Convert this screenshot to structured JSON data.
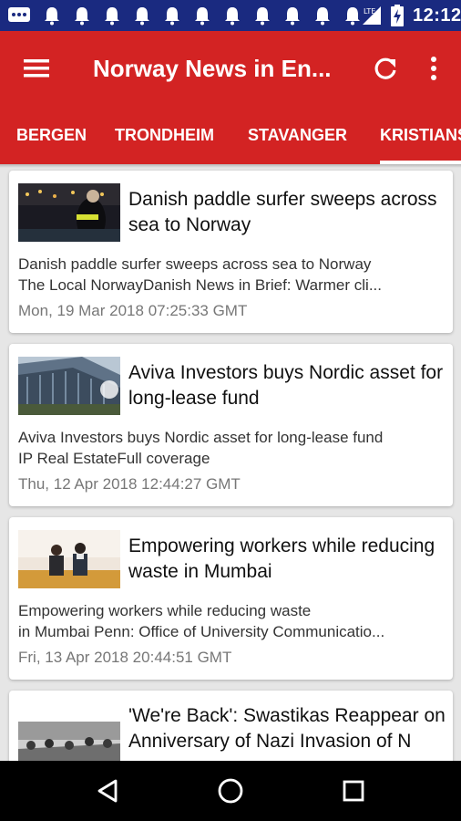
{
  "status_bar": {
    "time": "12:12",
    "network_label": "LTE",
    "notification_icons": [
      "message-icon",
      "bell-icon",
      "bell-icon",
      "bell-icon",
      "bell-icon",
      "bell-icon",
      "bell-icon",
      "bell-icon",
      "bell-icon",
      "bell-icon",
      "bell-icon",
      "bell-icon"
    ]
  },
  "app_bar": {
    "title": "Norway News in En...",
    "menu_icon": "hamburger-menu-icon",
    "refresh_icon": "refresh-icon",
    "more_icon": "more-vert-icon",
    "color": "#d32323"
  },
  "tabs": [
    {
      "label": "BERGEN"
    },
    {
      "label": "TRONDHEIM"
    },
    {
      "label": "STAVANGER"
    },
    {
      "label": "KRISTIANS"
    }
  ],
  "active_tab_index": 3,
  "articles": [
    {
      "title": "Danish paddle surfer sweeps across sea to Norway",
      "desc_line1": "Danish paddle surfer sweeps across sea to Norway",
      "desc_line2": "The Local NorwayDanish News in Brief: Warmer cli...",
      "date": "Mon, 19 Mar 2018 07:25:33 GMT"
    },
    {
      "title": "Aviva Investors buys Nordic asset for long-lease fund",
      "desc_line1": "Aviva Investors buys Nordic asset for long-lease fund",
      "desc_line2": "IP Real EstateFull coverage",
      "date": "Thu, 12 Apr 2018 12:44:27 GMT"
    },
    {
      "title": "Empowering workers while reducing waste in Mumbai",
      "desc_line1": "Empowering workers while reducing waste",
      "desc_line2": "in Mumbai  Penn: Office of University Communicatio...",
      "date": "Fri, 13 Apr 2018 20:44:51 GMT"
    },
    {
      "title": "'We're Back': Swastikas Reappear on Anniversary of Nazi Invasion of N",
      "desc_line1": "",
      "desc_line2": "",
      "date": ""
    }
  ],
  "nav_bar": {
    "back_icon": "back-triangle-icon",
    "home_icon": "home-circle-icon",
    "recents_icon": "recents-square-icon"
  }
}
